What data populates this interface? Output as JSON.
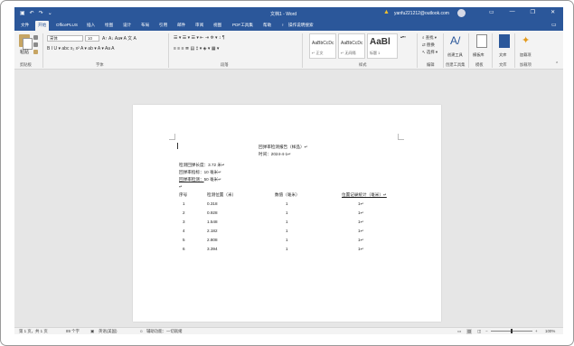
{
  "titlebar": {
    "doc_title": "文档1 - Word",
    "warning_icon": "warning-icon",
    "account": "yanfu221212@outlook.com",
    "minimize": "—",
    "restore": "❐",
    "close": "✕",
    "ribbon_options": "▭"
  },
  "tabs": [
    {
      "label": "文件"
    },
    {
      "label": "开始",
      "active": true
    },
    {
      "label": "OfficePLUS"
    },
    {
      "label": "插入"
    },
    {
      "label": "绘图"
    },
    {
      "label": "设计"
    },
    {
      "label": "布局"
    },
    {
      "label": "引用"
    },
    {
      "label": "邮件"
    },
    {
      "label": "审阅"
    },
    {
      "label": "视图"
    },
    {
      "label": "PDF工具集"
    },
    {
      "label": "帮助"
    },
    {
      "label": "操作说明搜索"
    }
  ],
  "ribbon": {
    "paste": "粘贴",
    "clipboard": "剪贴板",
    "font_name": "宋体",
    "font_size": "10",
    "font_row1": "A↑ A↓ Aa▾ A 文 A",
    "font_row2": "B I U ▾ abc x₂ x² A ▾ ab ▾ A ▾ Aa A",
    "font_group": "字体",
    "para_row1": "☰ ▾ ☰ ▾ ☰ ▾ ⇤ ⇥ ✲ ▾ ↕ ¶",
    "para_row2": "≡ ≡ ≡ ≣ ▤ ‡ ▾ ◈ ▾ ▦ ▾",
    "para_group": "段落",
    "styles": [
      {
        "sample": "AaBbCcDc",
        "name": "↵ 正文"
      },
      {
        "sample": "AaBbCcDc",
        "name": "↵ 无间隔"
      },
      {
        "sample": "AaBl",
        "name": "标题 1"
      }
    ],
    "styles_group": "样式",
    "find": "查找 ▾",
    "replace": "替换",
    "select": "选择 ▾",
    "edit_group": "编辑",
    "pdf_tool": "创建工具",
    "pdf_group": "创建工具集",
    "template": "模板库",
    "template_group": "模板",
    "doc_lib": "文库",
    "doc_group": "文库",
    "addin": "加载项",
    "addin_group": "加载项"
  },
  "document": {
    "title": "回弹率检测报告（样品）↵",
    "time": "时间：2024-4-1↵",
    "fields": [
      {
        "label": "检测回弹长度：",
        "value": "3.72 米↵"
      },
      {
        "label": "回弹率指标：",
        "value": "10 毫米↵"
      },
      {
        "label": "回弹率检测：",
        "value": "50 毫米↵"
      }
    ],
    "blank_para": "↵",
    "table_headers": [
      "序号",
      "检测位置（米）",
      "数值（毫米）",
      "位置记录统计（毫米）↵"
    ],
    "rows": [
      [
        "1",
        "0.318",
        "1",
        "1↵"
      ],
      [
        "2",
        "0.928",
        "1",
        "1↵"
      ],
      [
        "3",
        "1.548",
        "1",
        "1↵"
      ],
      [
        "4",
        "2.182",
        "1",
        "1↵"
      ],
      [
        "5",
        "2.808",
        "1",
        "1↵"
      ],
      [
        "6",
        "3.394",
        "1",
        "1↵"
      ]
    ]
  },
  "statusbar": {
    "page": "第 1 页，共 1 页",
    "words": "89 个字",
    "lang": "英语(美国)",
    "accessibility": "辅助功能：一切就绪",
    "zoom": "100%"
  }
}
